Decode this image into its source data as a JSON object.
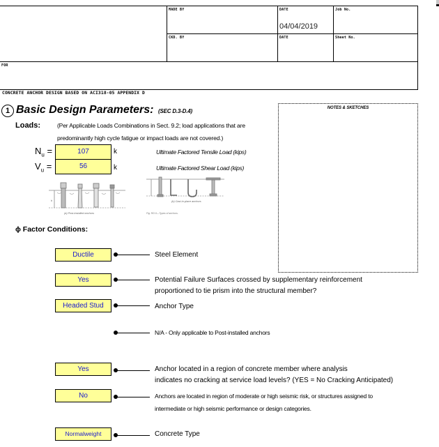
{
  "title_block": {
    "made_by_label": "MADE BY",
    "made_by_value": "",
    "date_label_1": "DATE",
    "date_value_1": "04/04/2019",
    "job_no_label": "Job No.",
    "job_no_value": "",
    "ckd_by_label": "CKD. BY",
    "ckd_by_value": "",
    "date_label_2": "DATE",
    "date_value_2": "",
    "sheet_no_label": "Sheet No.",
    "sheet_no_value": "",
    "for_label": "FOR",
    "for_value": ""
  },
  "sheet_title": "CONCRETE ANCHOR DESIGN BASED ON ACI318-05 APPENDIX D",
  "section": {
    "number": "1",
    "title": "Basic Design Parameters:",
    "reference": "(SEC D.3-D.4)"
  },
  "loads": {
    "label": "Loads:",
    "note_line1": "(Per Applicable Loads Combinations in Sect. 9.2; load applications that are",
    "note_line2": "predominantly high cycle fatigue or impact loads are not covered.)",
    "items": [
      {
        "symbol": "N",
        "subscript": "u",
        "equals": "=",
        "value": "107",
        "unit": "k",
        "description": "Ultimate Factored  Tensile Load (kips)"
      },
      {
        "symbol": "V",
        "subscript": "u",
        "equals": "=",
        "value": "56",
        "unit": "k",
        "description": "Ultimate Factored  Shear Load (kips)"
      }
    ]
  },
  "figure": {
    "caption_a": "(a) Post-installed anchors",
    "caption_b": "(b) Cast-in-place anchors",
    "caption_fig": "Fig. RD.0—Types of anchors.",
    "dim_label": "hef"
  },
  "notes": {
    "title": "NOTES & SKETCHES"
  },
  "factor_conditions": {
    "heading": "ϕ Factor Conditions:",
    "items": [
      {
        "value": "Ductile",
        "description": [
          "Steel Element"
        ]
      },
      {
        "value": "Yes",
        "description": [
          "Potential Failure Surfaces crossed by supplementary reinforcement",
          "proportioned to tie prism into the structural member?"
        ]
      },
      {
        "value": "Headed Stud",
        "description": [
          "Anchor Type"
        ]
      },
      {
        "value": "",
        "description": [
          "N/A - Only applicable to Post-installed anchors"
        ]
      },
      {
        "value": "Yes",
        "description": [
          "Anchor located in a region of concrete member where analysis",
          "indicates no cracking at service load levels? (YES = No Cracking Anticipated)"
        ]
      },
      {
        "value": "No",
        "description": [
          "Anchors are located in region of moderate or high seismic risk, or structures assigned to",
          "intermediate or high seismic performance or design categories."
        ]
      },
      {
        "value": "Normalweight",
        "description": [
          "Concrete Type"
        ]
      }
    ]
  },
  "colors": {
    "input_fill": "#ffff99",
    "input_text": "#1a1acc"
  }
}
